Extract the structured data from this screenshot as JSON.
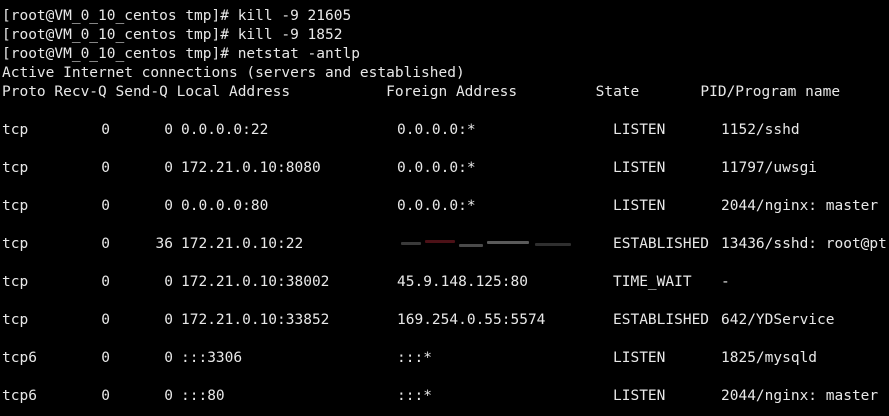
{
  "terminal": {
    "commands": [
      "[root@VM_0_10_centos tmp]# kill -9 21605",
      "[root@VM_0_10_centos tmp]# kill -9 1852",
      "[root@VM_0_10_centos tmp]# netstat -antlp"
    ],
    "info": "Active Internet connections (servers and established)",
    "headers": "Proto Recv-Q Send-Q Local Address           Foreign Address         State       PID/Program name",
    "rows": [
      {
        "proto": "tcp",
        "recvq": "0",
        "sendq": "0",
        "local": "0.0.0.0:22",
        "foreign": "0.0.0.0:*",
        "state": "LISTEN",
        "pid": "1152/sshd"
      },
      {
        "proto": "tcp",
        "recvq": "0",
        "sendq": "0",
        "local": "172.21.0.10:8080",
        "foreign": "0.0.0.0:*",
        "state": "LISTEN",
        "pid": "11797/uwsgi"
      },
      {
        "proto": "tcp",
        "recvq": "0",
        "sendq": "0",
        "local": "0.0.0.0:80",
        "foreign": "0.0.0.0:*",
        "state": "LISTEN",
        "pid": "2044/nginx: master"
      },
      {
        "proto": "tcp",
        "recvq": "0",
        "sendq": "36",
        "local": "172.21.0.10:22",
        "foreign": "",
        "state": "ESTABLISHED",
        "pid": "13436/sshd: root@pt"
      },
      {
        "proto": "tcp",
        "recvq": "0",
        "sendq": "0",
        "local": "172.21.0.10:38002",
        "foreign": "45.9.148.125:80",
        "state": "TIME_WAIT",
        "pid": "-"
      },
      {
        "proto": "tcp",
        "recvq": "0",
        "sendq": "0",
        "local": "172.21.0.10:33852",
        "foreign": "169.254.0.55:5574",
        "state": "ESTABLISHED",
        "pid": "642/YDService"
      },
      {
        "proto": "tcp6",
        "recvq": "0",
        "sendq": "0",
        "local": ":::3306",
        "foreign": ":::*",
        "state": "LISTEN",
        "pid": "1825/mysqld"
      },
      {
        "proto": "tcp6",
        "recvq": "0",
        "sendq": "0",
        "local": ":::80",
        "foreign": ":::*",
        "state": "LISTEN",
        "pid": "2044/nginx: master"
      }
    ]
  },
  "colors": {
    "background": "#000000",
    "foreground": "#e8e8e8"
  }
}
